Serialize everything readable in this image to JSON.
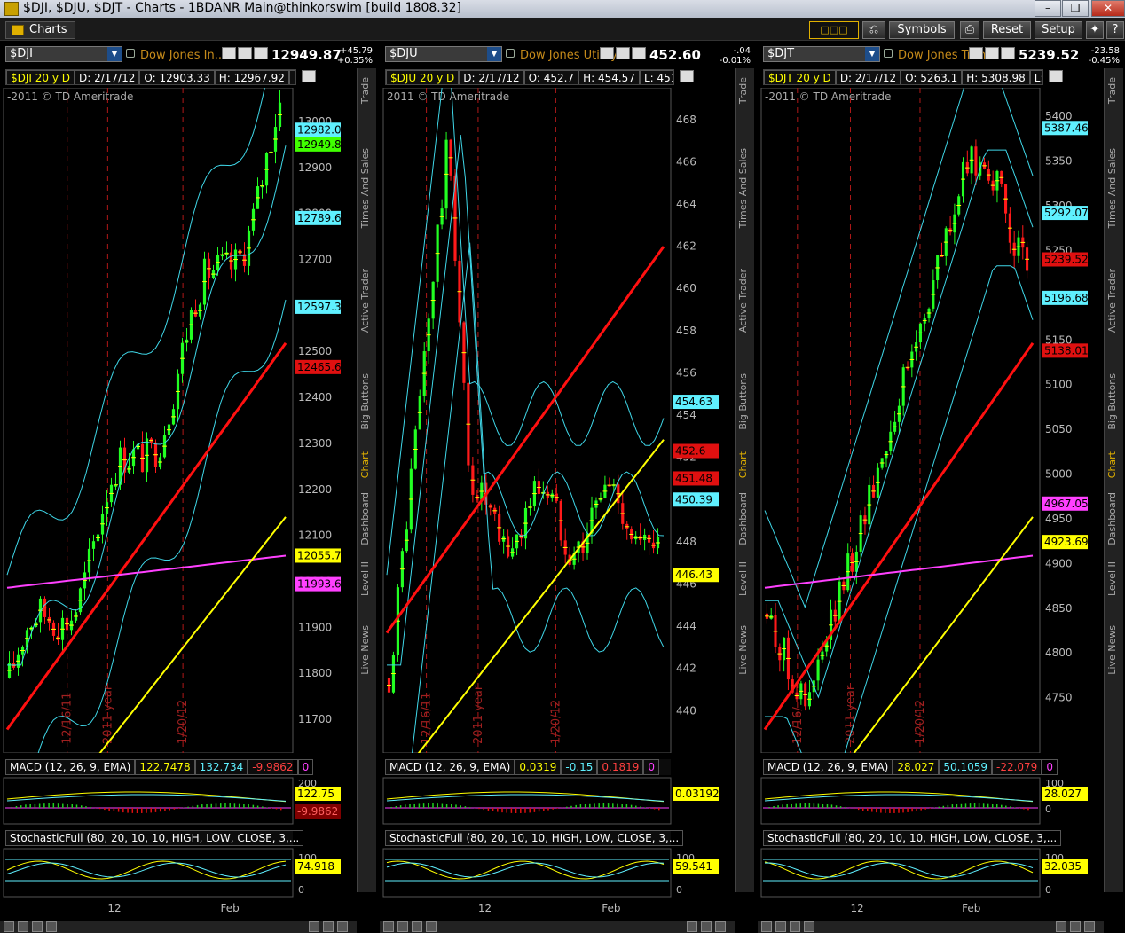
{
  "window": {
    "title": "$DJI, $DJU, $DJT - Charts - 1BDANR Main@thinkorswim [build 1808.32]"
  },
  "toolbar": {
    "tab": "Charts",
    "symbols": "Symbols",
    "reset": "Reset",
    "setup": "Setup"
  },
  "sidebar_tabs": [
    "Trade",
    "Times And Sales",
    "Active Trader",
    "Big Buttons",
    "Chart",
    "Dashboard",
    "Level II",
    "Live News"
  ],
  "panels": [
    {
      "symbol": "$DJI",
      "desc": "Dow Jones In...",
      "last": "12949.87",
      "chg": "+45.79",
      "chg_pct": "+0.35%",
      "info_parts": [
        "$DJI 20 y D",
        "D: 2/17/12",
        "O: 12903.33",
        "H: 12967.92",
        "L: ..."
      ],
      "copyright": "-2011 © TD Ameritrade",
      "y_ticks": [
        "13000",
        "12900",
        "12800",
        "12700",
        "12600",
        "12500",
        "12400",
        "12300",
        "12200",
        "12100",
        "12000",
        "11900",
        "11800",
        "11700"
      ],
      "y_min": 11650,
      "y_max": 13050,
      "labels": [
        {
          "text": "12982.02",
          "v": 12982,
          "bg": "#5ff0ff",
          "fg": "#000"
        },
        {
          "text": "12949.87",
          "v": 12950,
          "bg": "#40ff00",
          "fg": "#000"
        },
        {
          "text": "12789.68",
          "v": 12790,
          "bg": "#5ff0ff",
          "fg": "#000"
        },
        {
          "text": "12597.33",
          "v": 12597,
          "bg": "#5ff0ff",
          "fg": "#000"
        },
        {
          "text": "12465.6",
          "v": 12466,
          "bg": "#e01010",
          "fg": "#000"
        },
        {
          "text": "12055.72",
          "v": 12056,
          "bg": "#ffff00",
          "fg": "#000"
        },
        {
          "text": "11993.64",
          "v": 11994,
          "bg": "#ff40ff",
          "fg": "#000"
        }
      ],
      "vlines": [
        {
          "t": 0.22,
          "label": "12/16/11"
        },
        {
          "t": 0.36,
          "label": "2011 year"
        },
        {
          "t": 0.62,
          "label": "1/20/12"
        }
      ],
      "macd_hdr": [
        "MACD (12, 26, 9, EMA)",
        "122.7478",
        "132.734",
        "-9.9862",
        "0"
      ],
      "macd_labels": [
        {
          "text": "122.75",
          "bg": "#ffff00"
        },
        {
          "text": "-9.9862",
          "bg": "#800000",
          "fg": "#ff6060"
        }
      ],
      "macd_ticks": [
        "200",
        "0"
      ],
      "stoch_hdr": "StochasticFull (80, 20, 10, 10, HIGH, LOW, CLOSE, 3,...",
      "stoch_label": "74.918",
      "stoch_ticks": [
        "100",
        "0"
      ],
      "x_ticks": [
        {
          "t": 0.36,
          "label": "12"
        },
        {
          "t": 0.75,
          "label": "Feb"
        }
      ]
    },
    {
      "symbol": "$DJU",
      "desc": "Dow Jones Utility...",
      "last": "452.60",
      "chg": "-.04",
      "chg_pct": "-0.01%",
      "info_parts": [
        "$DJU 20 y D",
        "D: 2/17/12",
        "O: 452.7",
        "H: 454.57",
        "L: 451...."
      ],
      "copyright": "2011 © TD Ameritrade",
      "y_ticks": [
        "468",
        "466",
        "464",
        "462",
        "460",
        "458",
        "456",
        "454",
        "452",
        "450",
        "448",
        "446",
        "444",
        "442",
        "440"
      ],
      "y_min": 438.5,
      "y_max": 469,
      "labels": [
        {
          "text": "454.63",
          "v": 454.63,
          "bg": "#5ff0ff",
          "fg": "#000"
        },
        {
          "text": "452.6",
          "v": 452.3,
          "bg": "#e01010",
          "fg": "#000"
        },
        {
          "text": "451.48",
          "v": 451.0,
          "bg": "#e01010",
          "fg": "#000"
        },
        {
          "text": "450.39",
          "v": 450.0,
          "bg": "#5ff0ff",
          "fg": "#000"
        },
        {
          "text": "446.43",
          "v": 446.43,
          "bg": "#ffff00",
          "fg": "#000"
        }
      ],
      "vlines": [
        {
          "t": 0.15,
          "label": "12/16/11"
        },
        {
          "t": 0.33,
          "label": "2011 year"
        },
        {
          "t": 0.6,
          "label": "1/20/12"
        }
      ],
      "macd_hdr": [
        "MACD (12, 26, 9, EMA)",
        "0.0319",
        "-0.15",
        "0.1819",
        "0"
      ],
      "macd_labels": [
        {
          "text": "0.031927",
          "bg": "#ffff00"
        }
      ],
      "macd_ticks": [],
      "stoch_hdr": "StochasticFull (80, 20, 10, 10, HIGH, LOW, CLOSE, 3,...",
      "stoch_label": "59.541",
      "stoch_ticks": [
        "100",
        "0"
      ],
      "x_ticks": [
        {
          "t": 0.33,
          "label": "12"
        },
        {
          "t": 0.76,
          "label": "Feb"
        }
      ]
    },
    {
      "symbol": "$DJT",
      "desc": "Dow Jones Tran...",
      "last": "5239.52",
      "chg": "-23.58",
      "chg_pct": "-0.45%",
      "info_parts": [
        "$DJT 20 y D",
        "D: 2/17/12",
        "O: 5263.1",
        "H: 5308.98",
        "L: 52...."
      ],
      "copyright": "-2011 © TD Ameritrade",
      "y_ticks": [
        "5400",
        "5350",
        "5300",
        "5250",
        "5200",
        "5150",
        "5100",
        "5050",
        "5000",
        "4950",
        "4900",
        "4850",
        "4800",
        "4750"
      ],
      "y_min": 4700,
      "y_max": 5420,
      "labels": [
        {
          "text": "5387.46",
          "v": 5387,
          "bg": "#5ff0ff",
          "fg": "#000"
        },
        {
          "text": "5292.07",
          "v": 5292,
          "bg": "#5ff0ff",
          "fg": "#000"
        },
        {
          "text": "5239.52",
          "v": 5240,
          "bg": "#e01010",
          "fg": "#000"
        },
        {
          "text": "5196.68",
          "v": 5197,
          "bg": "#5ff0ff",
          "fg": "#000"
        },
        {
          "text": "5138.01",
          "v": 5138,
          "bg": "#e01010",
          "fg": "#000"
        },
        {
          "text": "4967.05",
          "v": 4967,
          "bg": "#ff40ff",
          "fg": "#000"
        },
        {
          "text": "4923.69",
          "v": 4924,
          "bg": "#ffff00",
          "fg": "#000"
        }
      ],
      "vlines": [
        {
          "t": 0.13,
          "label": "12/16/"
        },
        {
          "t": 0.32,
          "label": "2011 year"
        },
        {
          "t": 0.57,
          "label": "1/20/12"
        }
      ],
      "macd_hdr": [
        "MACD (12, 26, 9, EMA)",
        "28.027",
        "50.1059",
        "-22.079",
        "0"
      ],
      "macd_labels": [
        {
          "text": "28.027",
          "bg": "#ffff00"
        }
      ],
      "macd_ticks": [
        "100",
        "0"
      ],
      "stoch_hdr": "StochasticFull (80, 20, 10, 10, HIGH, LOW, CLOSE, 3,...",
      "stoch_label": "32.035",
      "stoch_ticks": [
        "100",
        "0"
      ],
      "x_ticks": [
        {
          "t": 0.32,
          "label": "12"
        },
        {
          "t": 0.72,
          "label": "Feb"
        }
      ]
    }
  ]
}
